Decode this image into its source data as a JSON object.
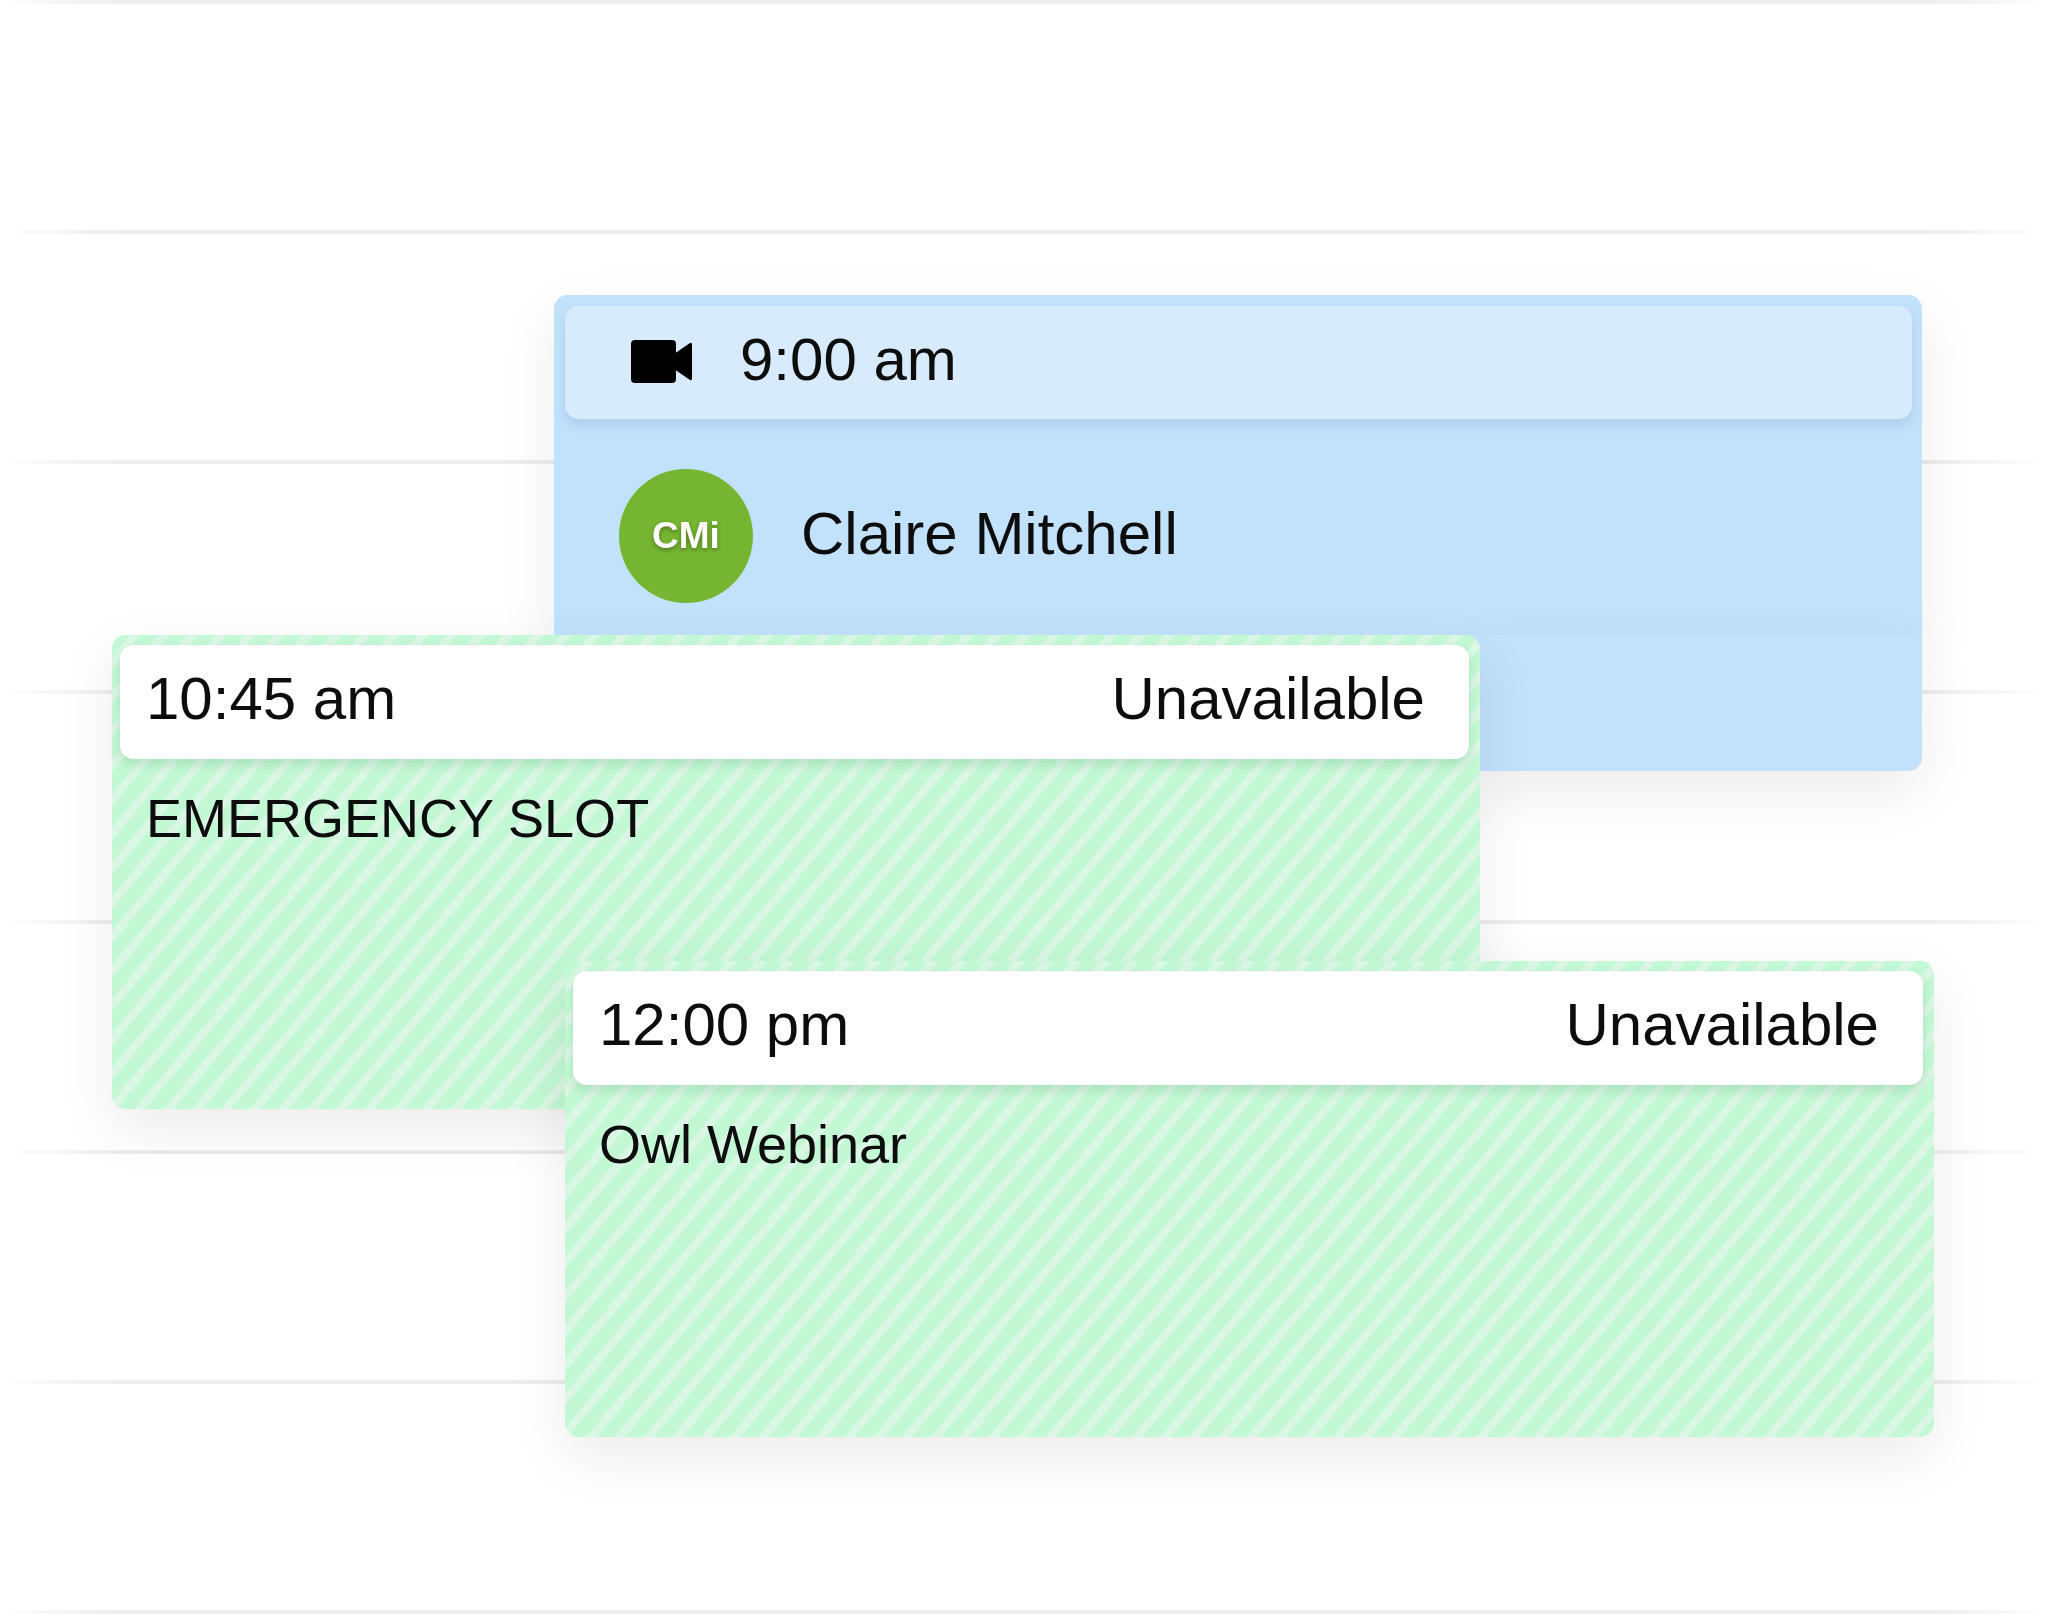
{
  "events": [
    {
      "kind": "appointment",
      "time": "9:00 am",
      "video": true,
      "attendee": {
        "initials": "CMi",
        "name": "Claire Mitchell"
      }
    },
    {
      "kind": "blocked",
      "time": "10:45 am",
      "status": "Unavailable",
      "title": "EMERGENCY SLOT"
    },
    {
      "kind": "blocked",
      "time": "12:00 pm",
      "status": "Unavailable",
      "title": "Owl Webinar"
    }
  ]
}
